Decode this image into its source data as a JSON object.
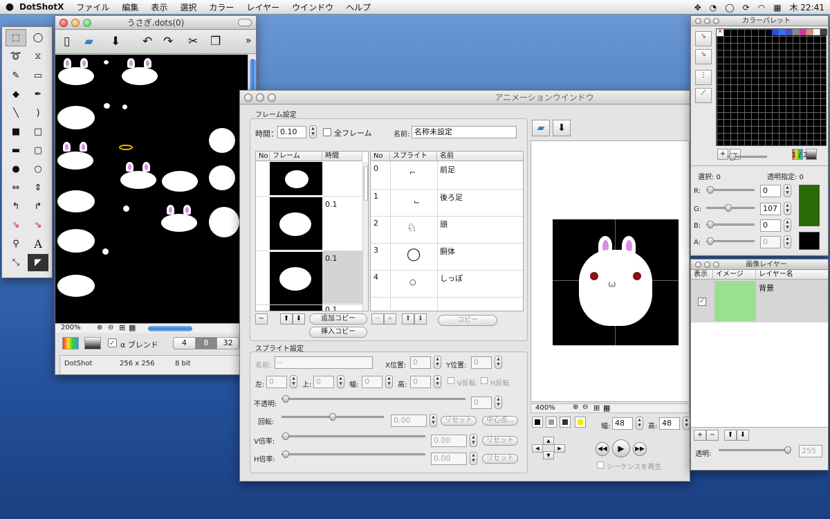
{
  "menubar": {
    "app": "DotShotX",
    "menus": [
      "ファイル",
      "編集",
      "表示",
      "選択",
      "カラー",
      "レイヤー",
      "ウインドウ",
      "ヘルプ"
    ],
    "clock": "木 22:41"
  },
  "canvas_window": {
    "title": "うさぎ.dots(0)",
    "zoom": "200%",
    "chart_toolbar": "»",
    "color_depth_options": [
      "4",
      "8",
      "32"
    ],
    "alpha_blend": "α ブレンド",
    "info": {
      "name": "DotShot",
      "size": "256 x 256",
      "depth": "8 bit"
    }
  },
  "animation_window": {
    "title": "アニメーションウインドウ",
    "frame_section": "フレーム設定",
    "time_label": "時間：",
    "time_value": "0.10",
    "all_frames": "全フレーム",
    "name_label": "名前:",
    "name_value": "名称未設定",
    "frame_table": {
      "headers": [
        "No",
        "フレーム",
        "時間"
      ],
      "times": [
        "",
        "0.1",
        "0.1",
        "0.1"
      ]
    },
    "sprite_table": {
      "headers": [
        "No",
        "スプライト",
        "名前"
      ],
      "rows": [
        {
          "no": "0",
          "name": "前足"
        },
        {
          "no": "1",
          "name": "後ろ足"
        },
        {
          "no": "2",
          "name": "頭"
        },
        {
          "no": "3",
          "name": "胴体"
        },
        {
          "no": "4",
          "name": "しっぽ"
        }
      ]
    },
    "add_copy": "追加コピー",
    "insert_copy": "挿入コピー",
    "copy": "コピー",
    "sprite_section": "スプライト設定",
    "sprite": {
      "name_label": "名前:",
      "name_value": "--",
      "x_label": "X位置:",
      "x_value": "0",
      "y_label": "Y位置:",
      "y_value": "0",
      "left_label": "左:",
      "left_value": "0",
      "top_label": "上:",
      "top_value": "0",
      "width_label": "幅:",
      "width_value": "0",
      "height_label": "高:",
      "height_value": "0",
      "vflip": "V反転",
      "hflip": "H反転",
      "opacity_label": "不透明:",
      "opacity_value": "0",
      "rotate_label": "回転:",
      "rotate_value": "0.00",
      "reset": "リセット",
      "center": "中心点...",
      "vscale_label": "V倍率:",
      "vscale_value": "0.00",
      "hscale_label": "H倍率:",
      "hscale_value": "0.00"
    },
    "preview": {
      "zoom": "400%",
      "width_label": "幅:",
      "width_value": "48",
      "height_label": "高:",
      "height_value": "48",
      "play_sequence": "シーケンスを再生"
    }
  },
  "palette": {
    "title": "カラーパレット",
    "page": "1 / 2",
    "selection_label": "選択: 0",
    "transparent_label": "透明指定: 0",
    "r_label": "R:",
    "r_value": "0",
    "g_label": "G:",
    "g_value": "107",
    "b_label": "B:",
    "b_value": "0",
    "a_label": "A:",
    "a_value": "0",
    "current_color": "#2a6b06"
  },
  "layers": {
    "title": "画像レイヤー",
    "headers": [
      "表示",
      "イメージ",
      "レイヤー名"
    ],
    "layer_name": "背景",
    "opacity_label": "透明:",
    "opacity_value": "255"
  }
}
